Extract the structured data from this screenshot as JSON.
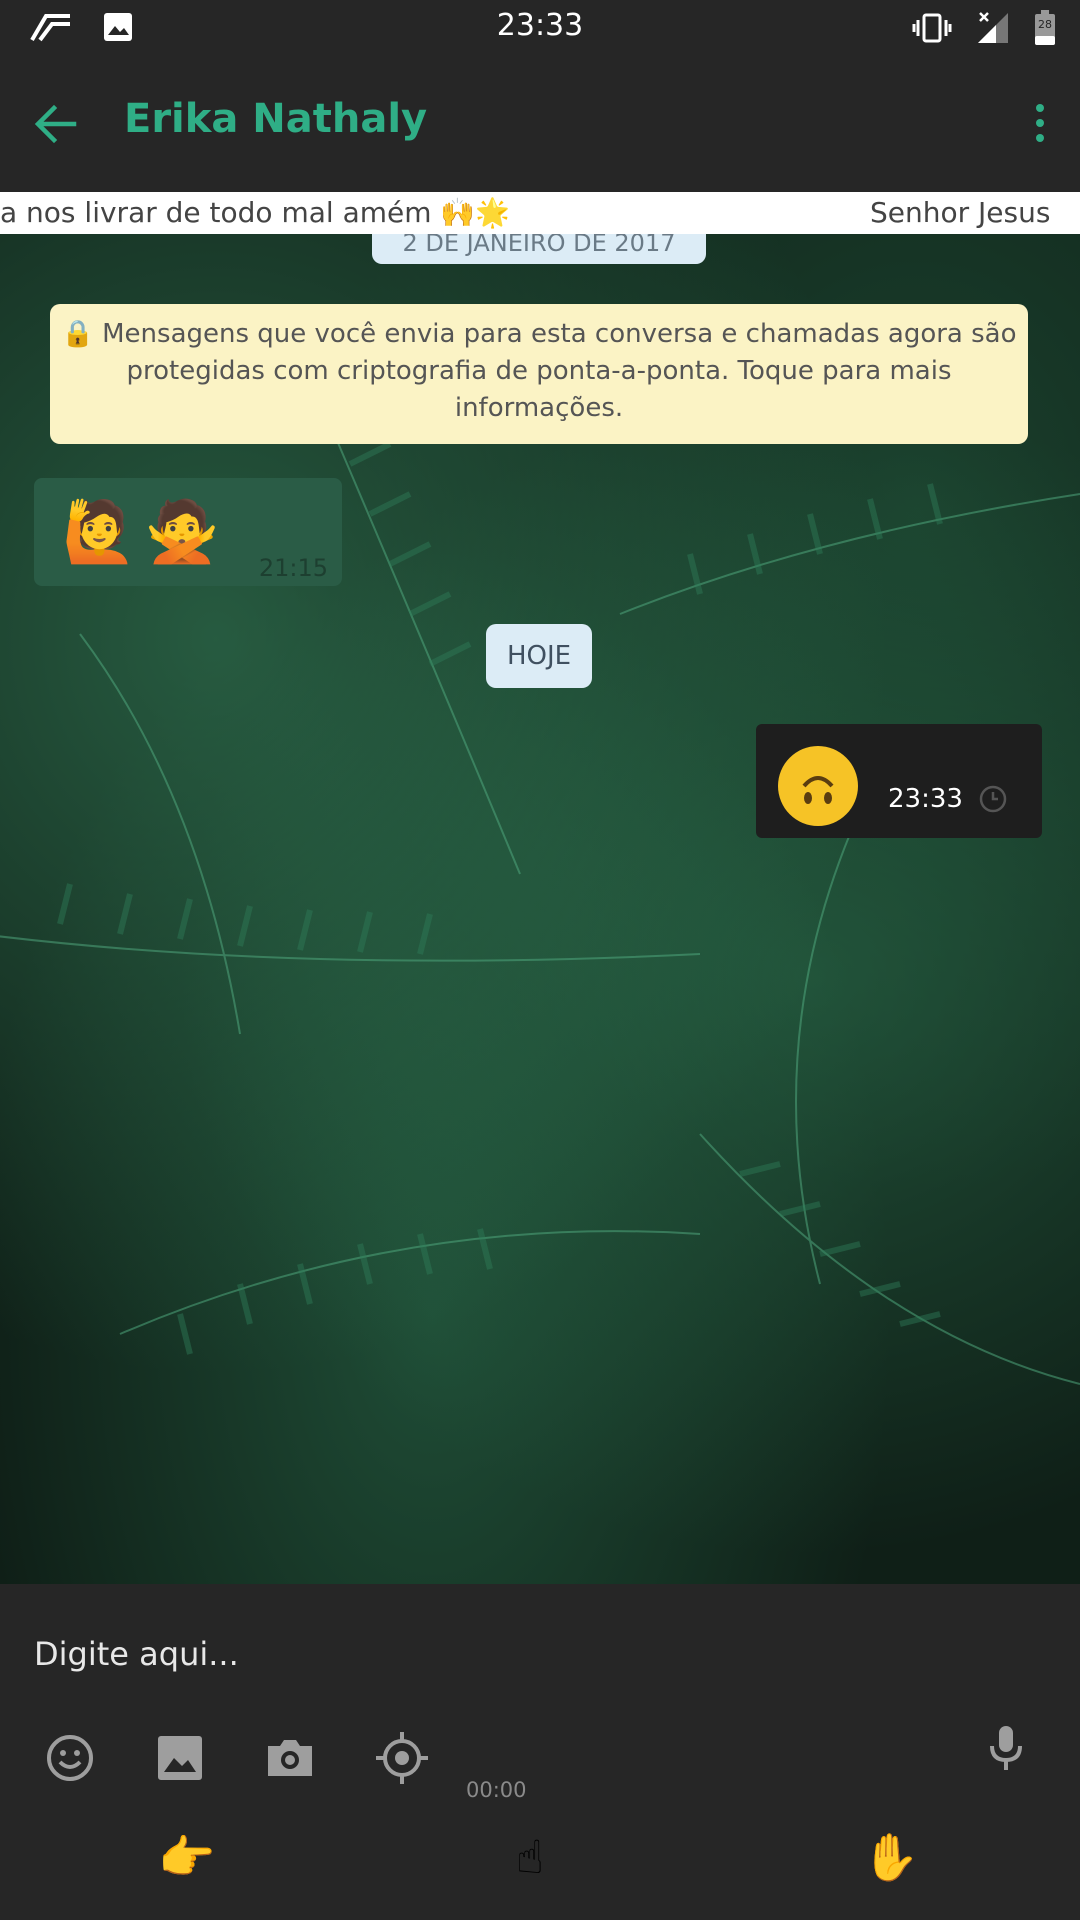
{
  "status_bar": {
    "time": "23:33",
    "battery": "28"
  },
  "header": {
    "contact_name": "Erika Nathaly"
  },
  "ticker": {
    "left_text": "a nos livrar de todo mal amém 🙌🌟",
    "right_text": "Senhor Jesus"
  },
  "chat": {
    "date_divider": "2 DE JANEIRO DE 2017",
    "encryption_notice": "🔒 Mensagens que você envia para esta conversa e chamadas agora são protegidas com criptografia de ponta-a-ponta. Toque para mais informações.",
    "messages": [
      {
        "direction": "incoming",
        "content": "🙋🙅",
        "time": "21:15"
      },
      {
        "direction": "outgoing",
        "content": "upside-down-face-emoji",
        "time": "23:33"
      }
    ],
    "today_divider": "HOJE"
  },
  "composer": {
    "placeholder": "Digite aqui...",
    "recording_time": "00:00",
    "tools": [
      "emoji-icon",
      "gallery-icon",
      "camera-icon",
      "location-icon",
      "microphone-icon"
    ],
    "gestures": [
      "👉",
      "☝",
      "✋"
    ]
  },
  "colors": {
    "accent": "#2fae86",
    "bar_background": "#262626",
    "notice_background": "#fbf3c5",
    "date_chip": "#dcecf6"
  }
}
